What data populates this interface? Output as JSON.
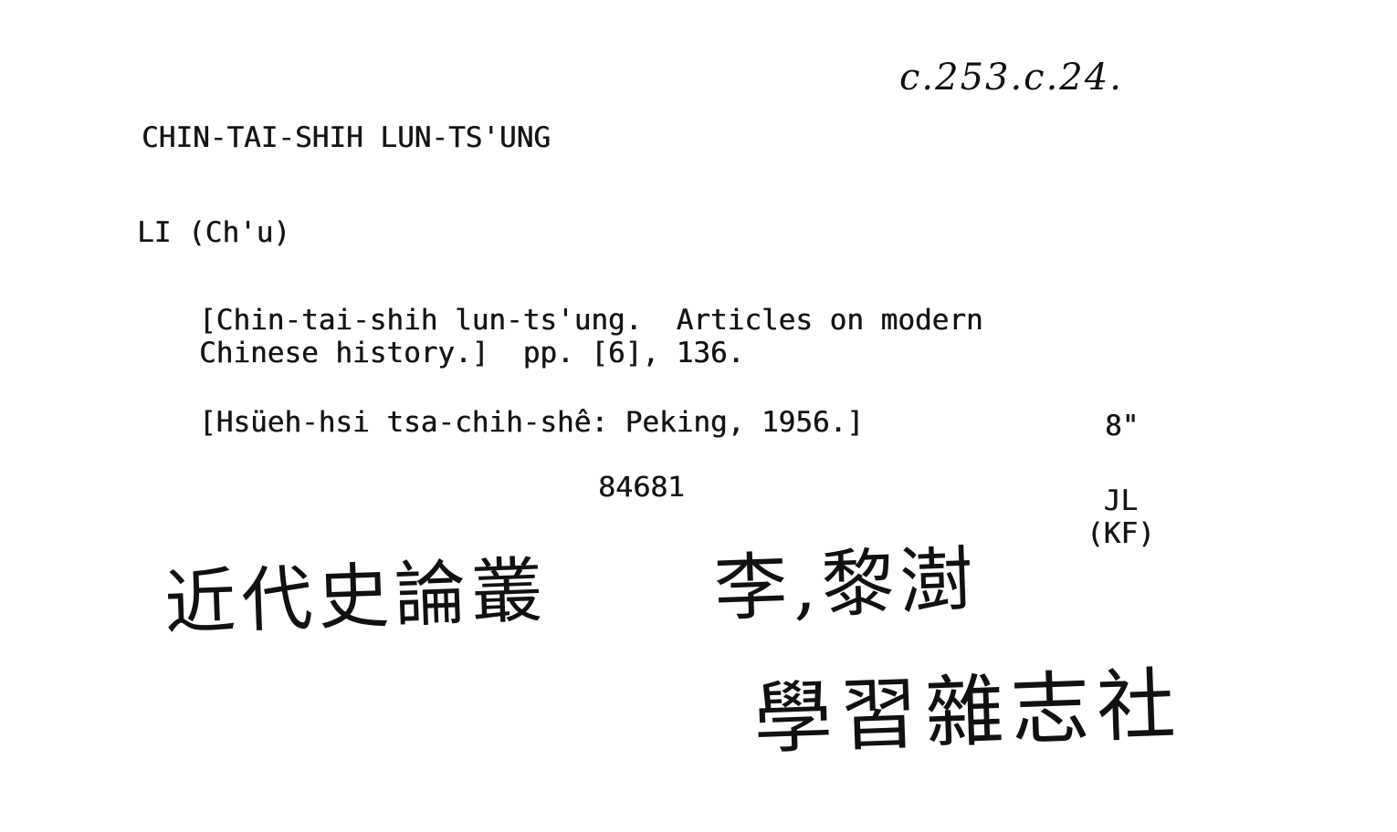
{
  "shelfmark": "c.253.c.24.",
  "heading": "CHIN-TAI-SHIH LUN-TS'UNG",
  "author": "LI (Ch'u)",
  "title_line_1": "[Chin-tai-shih lun-ts'ung.  Articles on modern",
  "title_line_2": "Chinese history.]  pp. [6], 136.",
  "imprint": "[Hsüeh-hsi tsa-chih-shê: Peking, 1956.]",
  "size": "8\"",
  "accession_number": "84681",
  "catalogue_code_line_1": "JL",
  "catalogue_code_line_2": "(KF)",
  "handwritten": {
    "title_chinese": "近代史論叢",
    "author_chinese": "李,黎澍",
    "publisher_chinese": "學習雜志社"
  }
}
